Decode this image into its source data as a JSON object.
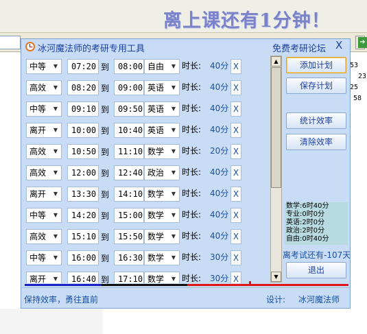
{
  "overlay": {
    "countdown": "离上课还有1分钟！"
  },
  "background": {
    "times": [
      "53",
      "23",
      "25",
      "58"
    ],
    "go_icon": "go-arrow-icon"
  },
  "window": {
    "title": "冰河魔法师的考研专用工具",
    "forum_link": "免费考研论坛",
    "close_label": "X",
    "icon": "alarm-clock-icon"
  },
  "schedule": {
    "to_label": "到",
    "duration_label": "时长:",
    "delete_label": "X",
    "rows": [
      {
        "mode": "中等",
        "start": "07:20",
        "end": "08:00",
        "subject": "自由",
        "duration": "40分"
      },
      {
        "mode": "高效",
        "start": "08:20",
        "end": "09:00",
        "subject": "英语",
        "duration": "40分"
      },
      {
        "mode": "中等",
        "start": "09:10",
        "end": "09:50",
        "subject": "英语",
        "duration": "40分"
      },
      {
        "mode": "离开",
        "start": "10:00",
        "end": "10:40",
        "subject": "英语",
        "duration": "40分"
      },
      {
        "mode": "高效",
        "start": "10:50",
        "end": "11:10",
        "subject": "数学",
        "duration": "20分"
      },
      {
        "mode": "高效",
        "start": "12:00",
        "end": "12:40",
        "subject": "政治",
        "duration": "40分"
      },
      {
        "mode": "离开",
        "start": "13:30",
        "end": "14:10",
        "subject": "数学",
        "duration": "40分"
      },
      {
        "mode": "中等",
        "start": "14:20",
        "end": "15:00",
        "subject": "数学",
        "duration": "40分"
      },
      {
        "mode": "高效",
        "start": "15:10",
        "end": "15:50",
        "subject": "数学",
        "duration": "40分"
      },
      {
        "mode": "中等",
        "start": "16:00",
        "end": "16:30",
        "subject": "数学",
        "duration": "30分"
      },
      {
        "mode": "离开",
        "start": "16:40",
        "end": "17:10",
        "subject": "数学",
        "duration": "30分"
      }
    ]
  },
  "actions": {
    "add_plan": "添加计划",
    "save_plan": "保存计划",
    "stats_efficiency": "统计效率",
    "clear_efficiency": "清除效率",
    "exit": "退出"
  },
  "stats": {
    "lines": [
      "数学:6时40分",
      "专业:0时0分",
      "英语:2时0分",
      "政治:2时0分",
      "自由:0时40分"
    ]
  },
  "exam_countdown": "离考试还有-107天",
  "statusbar": {
    "motto": "保持效率，勇往直前",
    "designer_label": "设计:",
    "designer_name": "冰河魔法师"
  },
  "colors": {
    "accent": "#1a3fa0",
    "window_bg": "#c9dcf5",
    "line_blue": "#1c23c4",
    "line_red": "#e0141a"
  }
}
